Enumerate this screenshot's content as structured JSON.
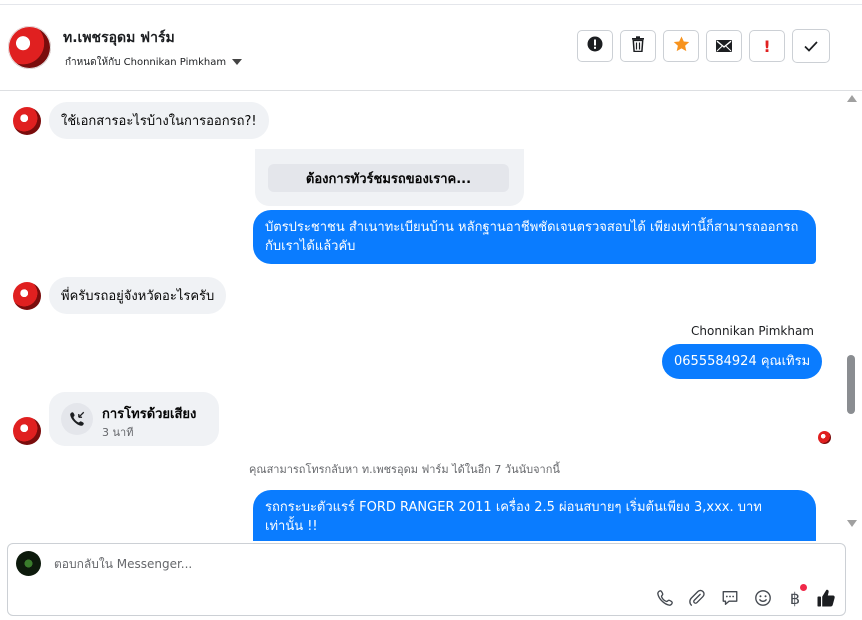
{
  "header": {
    "page_name": "ท.เพชรอุดม ฟาร์ม",
    "assigned_label": "กำหนดให้กับ Chonnikan Pimkham"
  },
  "toolbar": {
    "buttons": [
      {
        "icon": "alert-circle-icon"
      },
      {
        "icon": "trash-icon"
      },
      {
        "icon": "star-icon",
        "color": "#f7931e"
      },
      {
        "icon": "envelope-icon"
      },
      {
        "icon": "exclamation-icon",
        "text": "!",
        "color": "#e02020"
      },
      {
        "icon": "checkmark-icon"
      }
    ]
  },
  "messages": {
    "m1": "ใช้เอกสารอะไรบ้างในการออกรถ?!",
    "template_button": "ต้องการทัวร์ชมรถของเราค...",
    "m2": "บัตรประชาชน สำเนาทะเบียนบ้าน หลักฐานอาชีพชัดเจนตรวจสอบได้ เพียงเท่านี้ก็สามารถออกรถกับเราได้แล้วคับ",
    "m3": "พี่ครับรถอยู่จังหวัดอะไรครับ",
    "sender_name": "Chonnikan Pimkham",
    "m4": "0655584924 คุณเทิรม",
    "call_title": "การโทรด้วยเสียง",
    "call_duration": "3 นาที",
    "notice": "คุณสามารถโทรกลับหา ท.เพชรอุดม ฟาร์ม ได้ในอีก 7 วันนับจากนี้",
    "m5": "รถกระบะตัวแรร์ FORD RANGER 2011 เครื่อง 2.5 ผ่อนสบายๆ เริ่มต้นเพียง 3,xxx. บาท เท่านั้น !!"
  },
  "composer": {
    "placeholder": "ตอบกลับใน Messenger...",
    "icons": [
      "phone-icon",
      "paperclip-icon",
      "chat-bubble-icon",
      "smiley-icon",
      "baht-icon",
      "thumbs-up-icon"
    ],
    "accent_color": "#0a7cff"
  }
}
